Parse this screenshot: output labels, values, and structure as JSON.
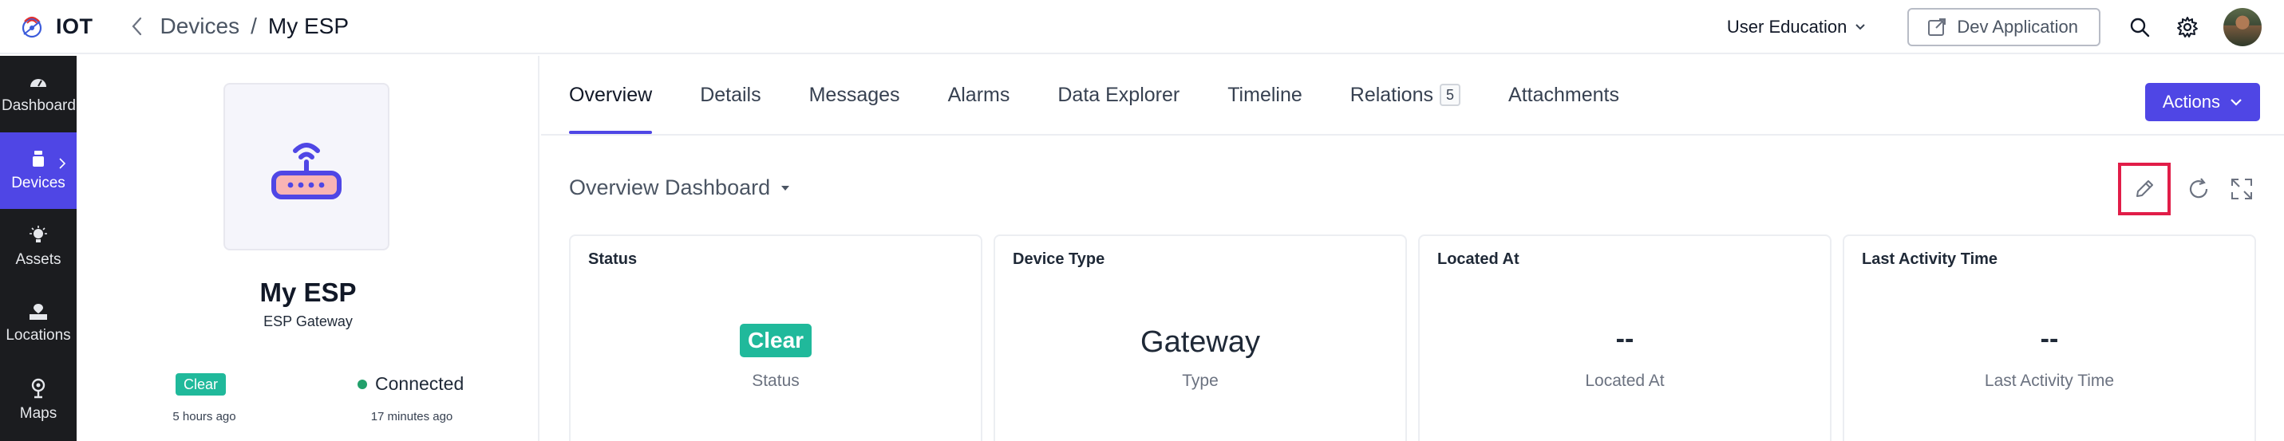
{
  "app": {
    "name": "IOT"
  },
  "breadcrumb": {
    "parent": "Devices",
    "separator": "/",
    "current": "My ESP"
  },
  "header": {
    "workspace": "User Education",
    "dev_app_label": "Dev Application"
  },
  "rail": {
    "items": [
      {
        "label": "Dashboards",
        "icon": "dashboard-icon"
      },
      {
        "label": "Devices",
        "icon": "device-icon",
        "active": true
      },
      {
        "label": "Assets",
        "icon": "asset-icon"
      },
      {
        "label": "Locations",
        "icon": "location-icon"
      },
      {
        "label": "Maps",
        "icon": "map-pin-icon"
      }
    ]
  },
  "device": {
    "name": "My ESP",
    "type": "ESP Gateway",
    "status": "Clear",
    "status_time": "5 hours ago",
    "connection": "Connected",
    "connection_time": "17 minutes ago"
  },
  "tabs": [
    {
      "label": "Overview",
      "active": true
    },
    {
      "label": "Details"
    },
    {
      "label": "Messages"
    },
    {
      "label": "Alarms"
    },
    {
      "label": "Data Explorer"
    },
    {
      "label": "Timeline"
    },
    {
      "label": "Relations",
      "badge": "5"
    },
    {
      "label": "Attachments"
    }
  ],
  "actions_label": "Actions",
  "dashboard": {
    "title": "Overview Dashboard"
  },
  "cards": [
    {
      "title": "Status",
      "value": "Clear",
      "subtitle": "Status"
    },
    {
      "title": "Device Type",
      "value": "Gateway",
      "subtitle": "Type"
    },
    {
      "title": "Located At",
      "value": "--",
      "subtitle": "Located At"
    },
    {
      "title": "Last Activity Time",
      "value": "--",
      "subtitle": "Last Activity Time"
    }
  ],
  "colors": {
    "accent": "#4f46e5",
    "status_clear": "#20b99b",
    "highlight": "#e11d48",
    "connected": "#22a06b"
  }
}
